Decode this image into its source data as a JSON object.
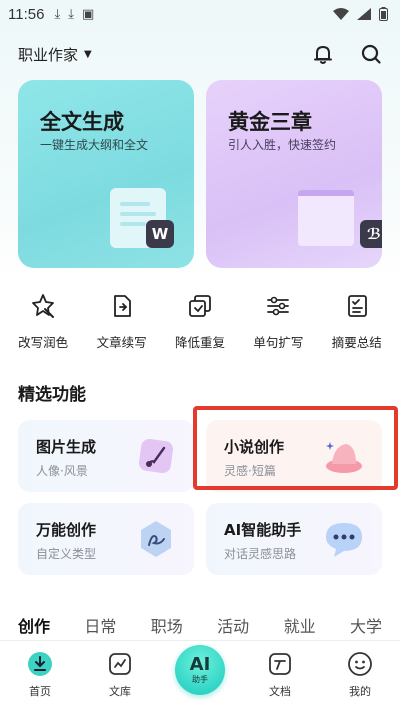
{
  "status_bar": {
    "time": "11:56"
  },
  "header": {
    "role_label": "职业作家"
  },
  "big_cards": [
    {
      "title": "全文生成",
      "subtitle": "一键生成大纲和全文",
      "badge": "W"
    },
    {
      "title": "黄金三章",
      "subtitle": "引人入胜，快速签约",
      "badge": "ℬ"
    }
  ],
  "tools": [
    {
      "label": "改写润色",
      "icon": "magic-wand-icon"
    },
    {
      "label": "文章续写",
      "icon": "continue-writing-icon"
    },
    {
      "label": "降低重复",
      "icon": "reduce-duplicate-icon"
    },
    {
      "label": "单句扩写",
      "icon": "expand-sentence-icon"
    },
    {
      "label": "摘要总结",
      "icon": "summary-icon"
    }
  ],
  "section": {
    "title": "精选功能"
  },
  "features": [
    {
      "title": "图片生成",
      "subtitle": "人像·风景",
      "icon": "image-brush-icon"
    },
    {
      "title": "小说创作",
      "subtitle": "灵感·短篇",
      "icon": "hat-icon"
    },
    {
      "title": "万能创作",
      "subtitle": "自定义类型",
      "icon": "hexagon-pen-icon"
    },
    {
      "title": "AI智能助手",
      "subtitle": "对话灵感思路",
      "icon": "chat-bubble-icon"
    }
  ],
  "categories": [
    "创作",
    "日常",
    "职场",
    "活动",
    "就业",
    "大学"
  ],
  "bottom_nav": {
    "home": "首页",
    "library": "文库",
    "ai_main": "AI",
    "ai_sub": "助手",
    "docs": "文档",
    "mine": "我的"
  },
  "colors": {
    "accent": "#4ed0d4",
    "highlight": "#e23b2d"
  }
}
